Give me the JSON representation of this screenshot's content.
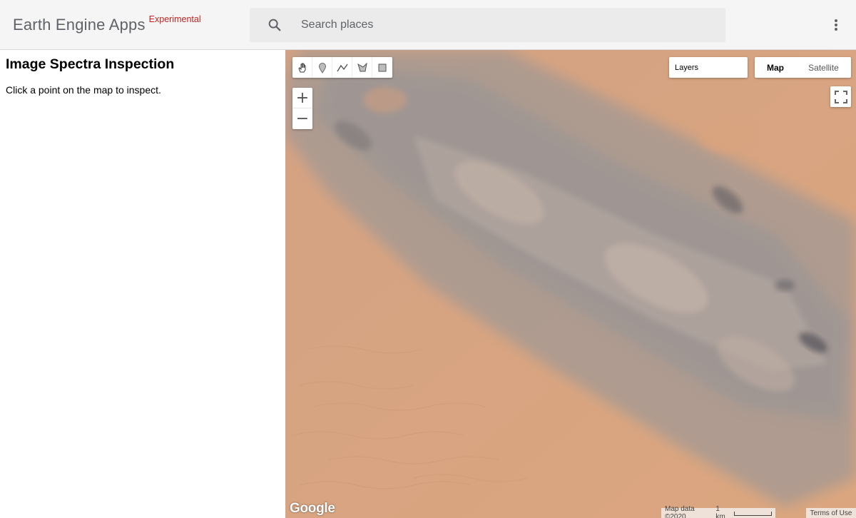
{
  "header": {
    "brand_title": "Earth Engine Apps",
    "brand_badge": "Experimental",
    "search_placeholder": "Search places",
    "search_icon": "search-icon",
    "menu_icon": "more-vert-icon"
  },
  "panel": {
    "title": "Image Spectra Inspection",
    "instruction": "Click a point on the map to inspect."
  },
  "map": {
    "draw_tools": [
      "hand-pan-icon",
      "point-marker-icon",
      "line-icon",
      "polygon-icon",
      "rectangle-icon"
    ],
    "zoom_in_label": "+",
    "zoom_out_label": "−",
    "layers_label": "Layers",
    "map_type_options": [
      "Map",
      "Satellite"
    ],
    "map_type_selected": "Map",
    "fullscreen_icon": "fullscreen-icon",
    "google_logo": "Google",
    "attribution": "Map data ©2020",
    "scale_label": "1 km",
    "terms_label": "Terms of Use"
  },
  "colors": {
    "sand": "#d6a07f",
    "rock_gray": "#9d9a9a",
    "badge_red": "#c5221f",
    "header_bg": "#f5f5f5"
  }
}
